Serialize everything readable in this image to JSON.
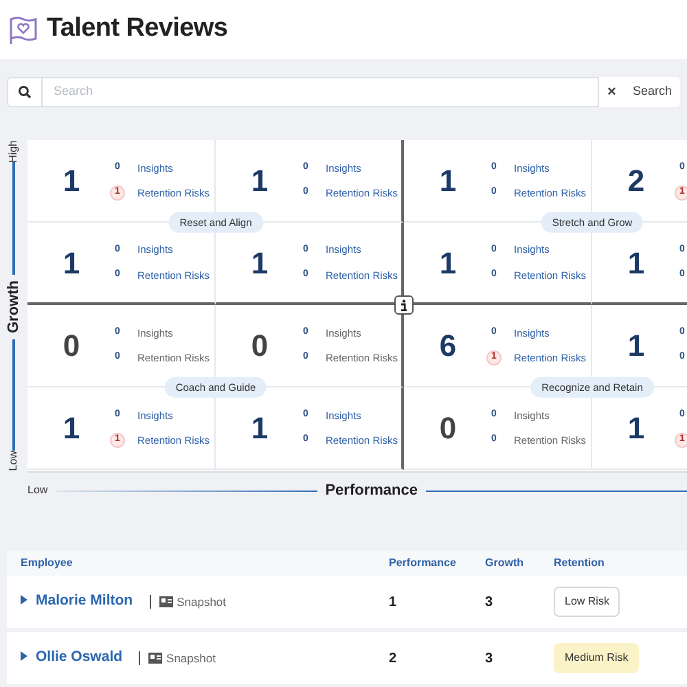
{
  "header": {
    "title": "Talent Reviews"
  },
  "search": {
    "placeholder": "Search",
    "clear": "×",
    "button": "Search"
  },
  "matrix": {
    "y_axis": {
      "high": "High",
      "title": "Growth",
      "low": "Low"
    },
    "x_axis": {
      "low": "Low",
      "title": "Performance"
    },
    "rows": [
      [
        {
          "count": "1",
          "muted": false,
          "insights": "0",
          "insights_label": "Insights",
          "risks": "1",
          "at_risk": true,
          "risks_label": "Retention Risks"
        },
        {
          "count": "1",
          "muted": false,
          "insights": "0",
          "insights_label": "Insights",
          "risks": "0",
          "at_risk": false,
          "risks_label": "Retention Risks"
        },
        {
          "count": "1",
          "muted": false,
          "insights": "0",
          "insights_label": "Insights",
          "risks": "0",
          "at_risk": false,
          "risks_label": "Retention Risks"
        },
        {
          "count": "2",
          "muted": false,
          "insights": "0",
          "risks": "1",
          "at_risk": true
        }
      ],
      [
        {
          "count": "1",
          "muted": false,
          "insights": "0",
          "insights_label": "Insights",
          "risks": "0",
          "at_risk": false,
          "risks_label": "Retention Risks"
        },
        {
          "count": "1",
          "muted": false,
          "insights": "0",
          "insights_label": "Insights",
          "risks": "0",
          "at_risk": false,
          "risks_label": "Retention Risks"
        },
        {
          "count": "1",
          "muted": false,
          "insights": "0",
          "insights_label": "Insights",
          "risks": "0",
          "at_risk": false,
          "risks_label": "Retention Risks"
        },
        {
          "count": "1",
          "muted": false,
          "insights": "0",
          "risks": "0",
          "at_risk": false
        }
      ],
      [
        {
          "count": "0",
          "muted": true,
          "insights": "0",
          "insights_label": "Insights",
          "risks": "0",
          "at_risk": false,
          "risks_label": "Retention Risks"
        },
        {
          "count": "0",
          "muted": true,
          "insights": "0",
          "insights_label": "Insights",
          "risks": "0",
          "at_risk": false,
          "risks_label": "Retention Risks"
        },
        {
          "count": "6",
          "muted": false,
          "insights": "0",
          "insights_label": "Insights",
          "risks": "1",
          "at_risk": true,
          "risks_label": "Retention Risks"
        },
        {
          "count": "1",
          "muted": false,
          "insights": "0",
          "risks": "0",
          "at_risk": false
        }
      ],
      [
        {
          "count": "1",
          "muted": false,
          "insights": "0",
          "insights_label": "Insights",
          "risks": "1",
          "at_risk": true,
          "risks_label": "Retention Risks"
        },
        {
          "count": "1",
          "muted": false,
          "insights": "0",
          "insights_label": "Insights",
          "risks": "0",
          "at_risk": false,
          "risks_label": "Retention Risks"
        },
        {
          "count": "0",
          "muted": true,
          "insights": "0",
          "insights_label": "Insights",
          "risks": "0",
          "at_risk": false,
          "risks_label": "Retention Risks"
        },
        {
          "count": "1",
          "muted": false,
          "insights": "0",
          "risks": "1",
          "at_risk": true
        }
      ]
    ],
    "quadrant_labels": [
      "Reset and Align",
      "Stretch and Grow",
      "Coach and Guide",
      "Recognize and Retain"
    ]
  },
  "table": {
    "columns": [
      "Employee",
      "Performance",
      "Growth",
      "Retention"
    ],
    "rows": [
      {
        "name": "Malorie Milton",
        "link": "Snapshot",
        "performance": "1",
        "growth": "3",
        "retention": "Low Risk",
        "kind": "outlined"
      },
      {
        "name": "Ollie Oswald",
        "link": "Snapshot",
        "performance": "2",
        "growth": "3",
        "retention": "Medium Risk",
        "kind": "highlighted"
      }
    ]
  }
}
